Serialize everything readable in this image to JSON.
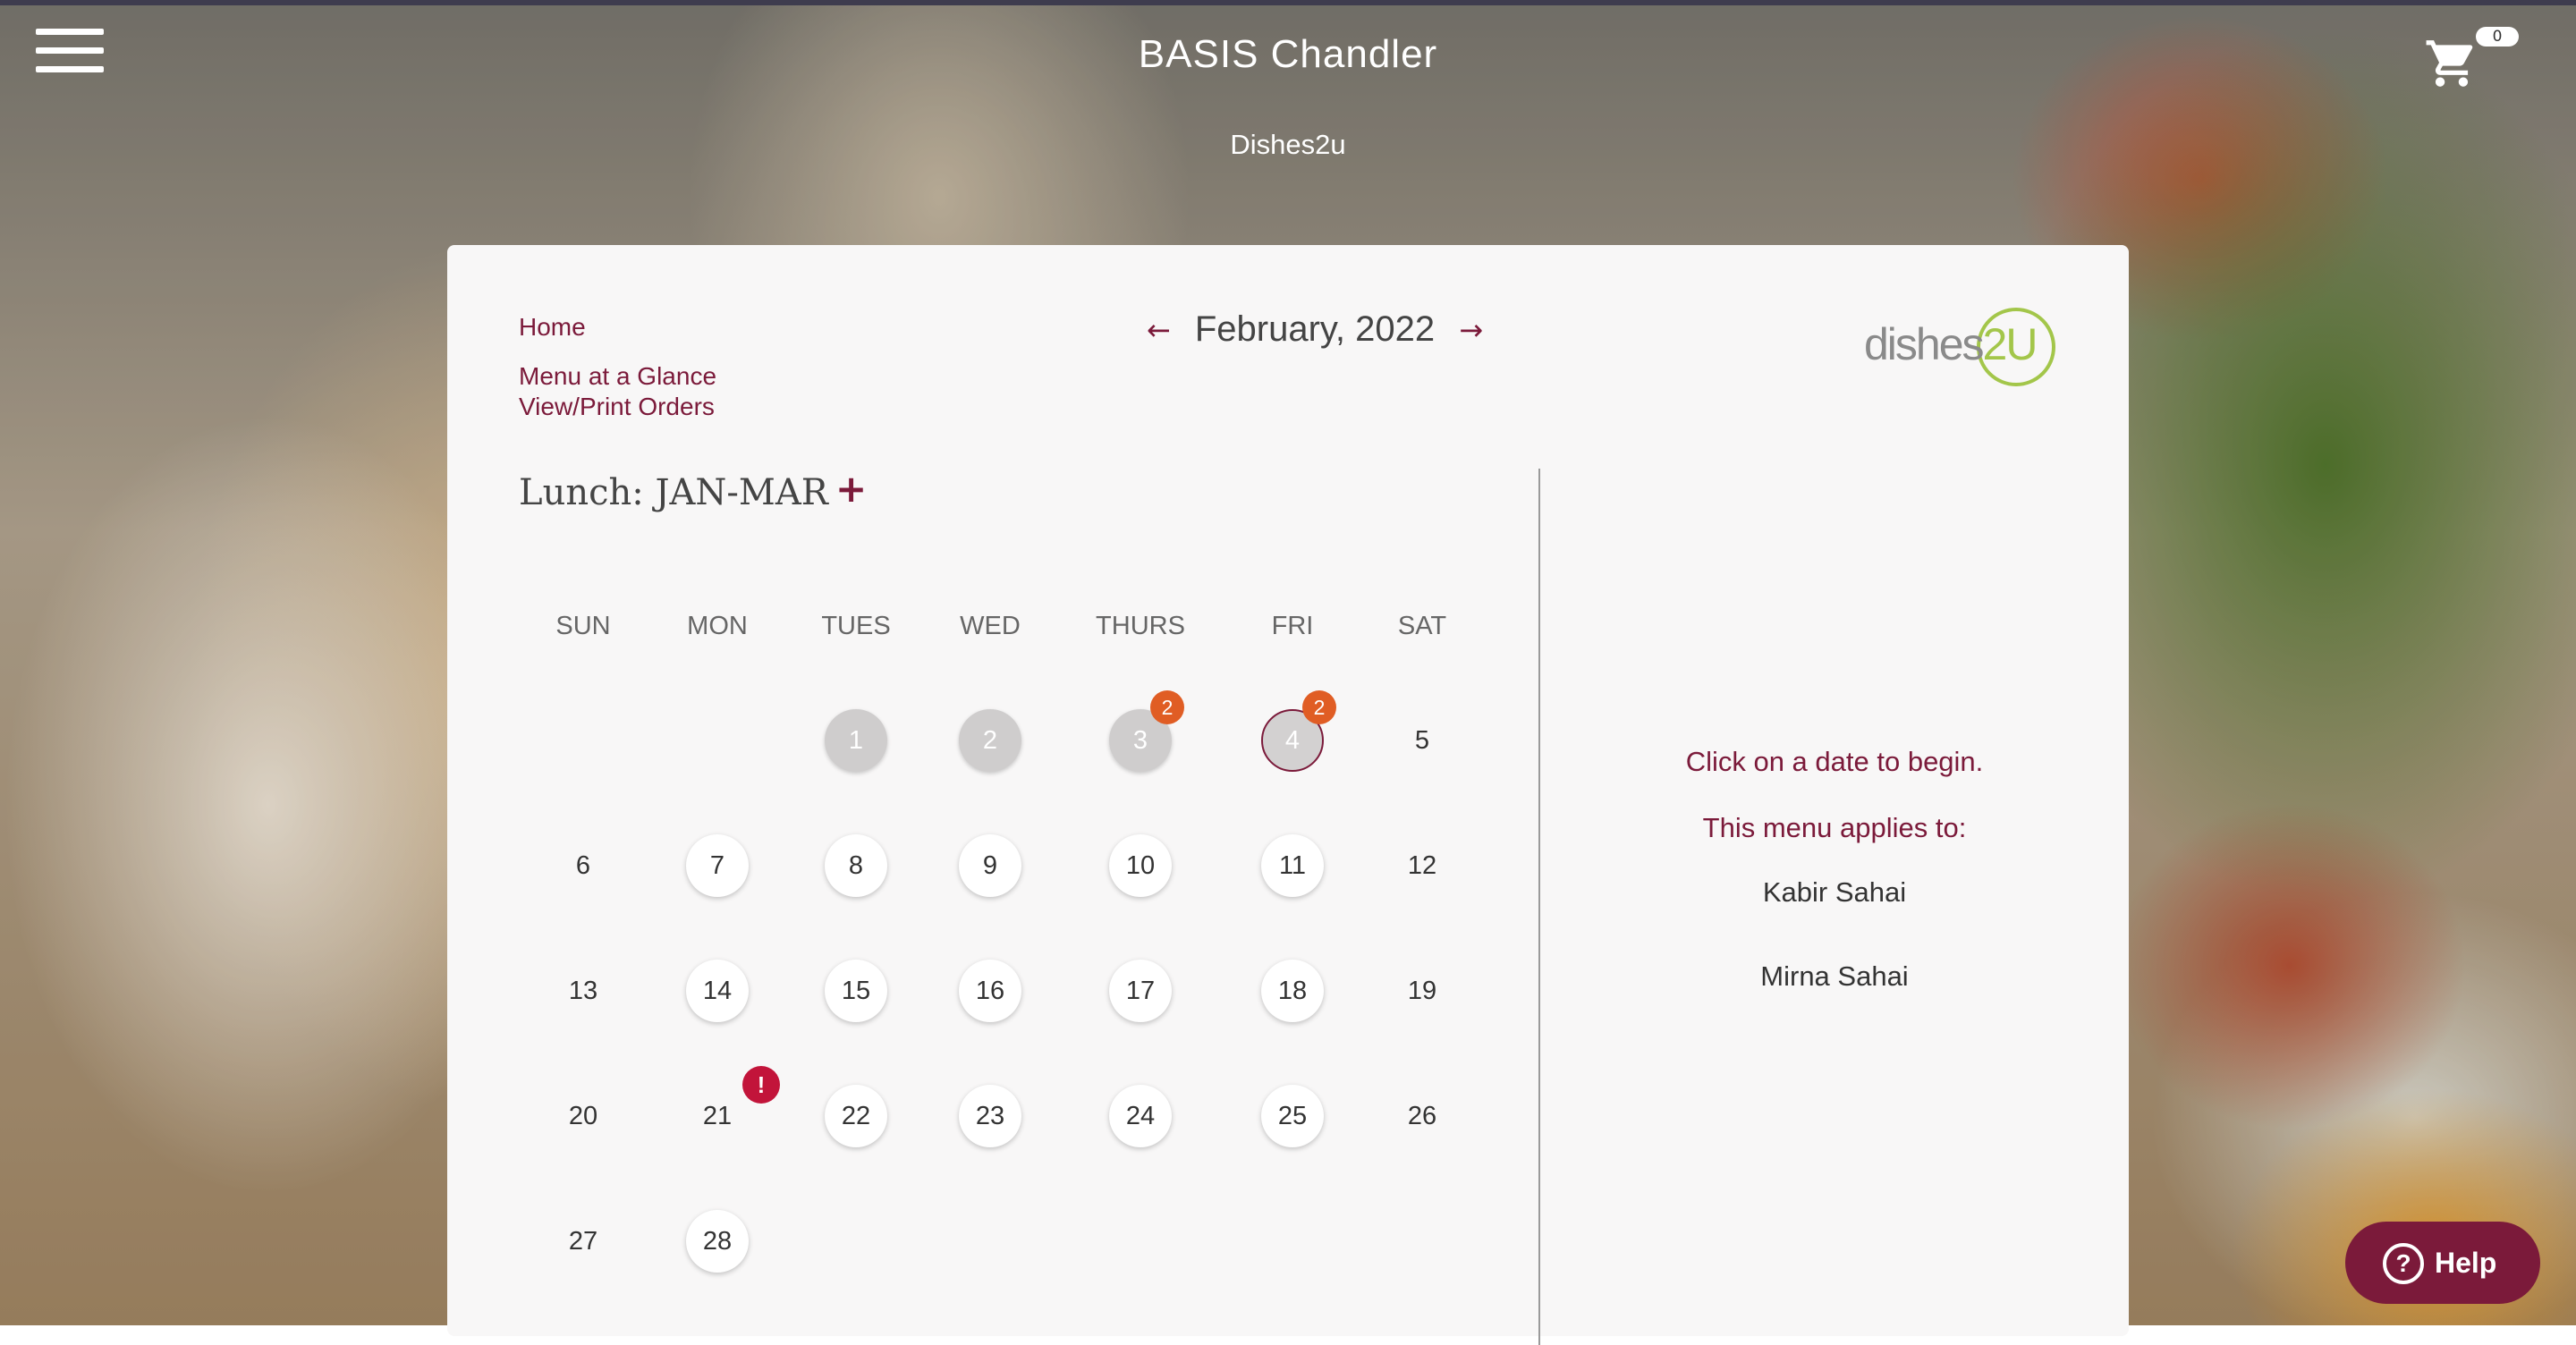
{
  "header": {
    "school_name": "BASIS Chandler",
    "vendor_name": "Dishes2u",
    "cart_count": "0"
  },
  "nav": {
    "home": "Home",
    "menu_at_a_glance": "Menu at a Glance",
    "view_print_orders": "View/Print Orders"
  },
  "calendar": {
    "prev_arrow": "←",
    "next_arrow": "→",
    "month_label": "February, 2022",
    "menu_title": "Lunch: JAN-MAR",
    "add_label": "+",
    "weekdays": [
      "SUN",
      "MON",
      "TUES",
      "WED",
      "THURS",
      "FRI",
      "SAT"
    ],
    "days": [
      {
        "label": "1",
        "state": "past"
      },
      {
        "label": "2",
        "state": "past"
      },
      {
        "label": "3",
        "state": "past",
        "badge": "2"
      },
      {
        "label": "4",
        "state": "today",
        "badge": "2"
      },
      {
        "label": "5",
        "state": "plain"
      },
      {
        "label": "6",
        "state": "plain"
      },
      {
        "label": "7",
        "state": "available"
      },
      {
        "label": "8",
        "state": "available"
      },
      {
        "label": "9",
        "state": "available"
      },
      {
        "label": "10",
        "state": "available"
      },
      {
        "label": "11",
        "state": "available"
      },
      {
        "label": "12",
        "state": "plain"
      },
      {
        "label": "13",
        "state": "plain"
      },
      {
        "label": "14",
        "state": "available"
      },
      {
        "label": "15",
        "state": "available"
      },
      {
        "label": "16",
        "state": "available"
      },
      {
        "label": "17",
        "state": "available"
      },
      {
        "label": "18",
        "state": "available"
      },
      {
        "label": "19",
        "state": "plain"
      },
      {
        "label": "20",
        "state": "plain"
      },
      {
        "label": "21",
        "state": "plain",
        "alert": "!"
      },
      {
        "label": "22",
        "state": "available"
      },
      {
        "label": "23",
        "state": "available"
      },
      {
        "label": "24",
        "state": "available"
      },
      {
        "label": "25",
        "state": "available"
      },
      {
        "label": "26",
        "state": "plain"
      },
      {
        "label": "27",
        "state": "plain"
      },
      {
        "label": "28",
        "state": "available"
      }
    ]
  },
  "right_panel": {
    "instruction": "Click on a date to begin.",
    "applies_to": "This menu applies to:",
    "students": [
      "Kabir Sahai",
      "Mirna Sahai"
    ]
  },
  "help": {
    "icon": "?",
    "label": "Help"
  },
  "logo": {
    "text_left": "dishes",
    "text_right": "2U"
  },
  "colors": {
    "accent": "#7b1a3a",
    "badge_orange": "#e05d24",
    "alert_red": "#c2143a",
    "logo_green": "#a3c64a"
  }
}
